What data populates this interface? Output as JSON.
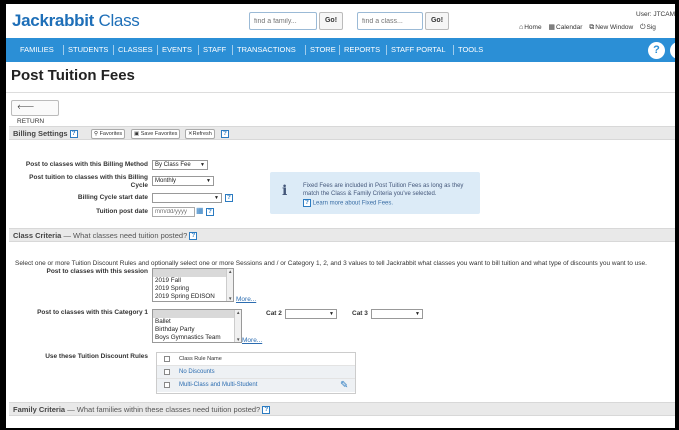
{
  "app": {
    "logo_main": "Jackrabbit",
    "logo_sub": " Class",
    "family_search_placeholder": "find a family...",
    "class_search_placeholder": "find a class...",
    "go_label": "Go!",
    "user_label": "User: JTCAM",
    "links": {
      "home": "Home",
      "calendar": "Calendar",
      "new_window": "New Window",
      "sign": "Sig"
    }
  },
  "nav": {
    "items": [
      "FAMILIES",
      "STUDENTS",
      "CLASSES",
      "EVENTS",
      "STAFF",
      "TRANSACTIONS",
      "STORE",
      "REPORTS",
      "STAFF PORTAL",
      "TOOLS"
    ],
    "help": "?"
  },
  "page": {
    "title": "Post Tuition Fees",
    "return_label": "RETURN"
  },
  "billing": {
    "header": "Billing Settings",
    "help": "?",
    "favorites": "Favorites",
    "save_favorites": "Save Favorites",
    "refresh": "Refresh",
    "method_label": "Post to classes with this Billing Method",
    "method_value": "By Class Fee",
    "cycle_label_1": "Post tuition to classes with this Billing",
    "cycle_label_2": "Cycle",
    "cycle_value": "Monthly",
    "start_label": "Billing Cycle start date",
    "start_value": "",
    "post_date_label": "Tuition post date",
    "post_date_placeholder": "mm/dd/yyyy",
    "info_text": "Fixed Fees are included in Post Tuition Fees as long as they match the Class & Family Criteria you've selected.",
    "info_link": "Learn more about Fixed Fees."
  },
  "class_criteria": {
    "header": "Class Criteria",
    "subheader": " — What classes need tuition posted?",
    "help": "?",
    "description": "Select one or more Tuition Discount Rules and optionally select one or more Sessions and / or Category 1, 2, and 3 values to tell Jackrabbit what classes you want to bill tuition and what type of discounts you want to use.",
    "session_label": "Post to classes with this session",
    "sessions": [
      "",
      "2019 Fall",
      "2019 Spring",
      "2019 Spring EDISON"
    ],
    "more": "More...",
    "cat1_label": "Post to classes with this Category 1",
    "cat1": [
      "",
      "Ballet",
      "Birthday Party",
      "Boys Gymnastics Team"
    ],
    "cat2_label": "Cat 2",
    "cat3_label": "Cat 3",
    "discount_label": "Use these Tuition Discount Rules",
    "discount_header": "Class Rule Name",
    "discount_rules": [
      "No Discounts",
      "Multi-Class and Multi-Student"
    ]
  },
  "family_criteria": {
    "header": "Family Criteria",
    "subheader": " — What families within these classes need tuition posted?",
    "help": "?"
  }
}
